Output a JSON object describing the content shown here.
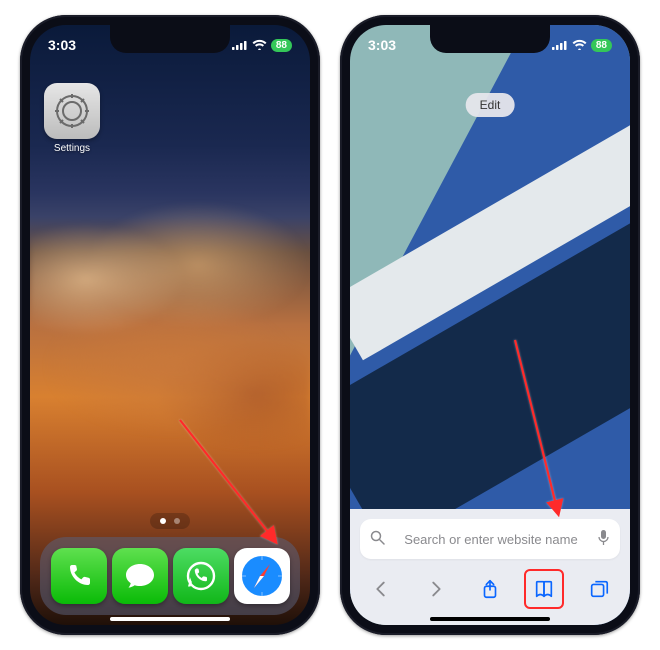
{
  "left": {
    "status_time": "3:03",
    "battery_pct": "88",
    "settings_label": "Settings",
    "dock": {
      "phone": "Phone",
      "messages": "Messages",
      "whatsapp": "WhatsApp",
      "safari": "Safari"
    }
  },
  "right": {
    "status_time": "3:03",
    "battery_pct": "88",
    "edit_label": "Edit",
    "search_placeholder": "Search or enter website name",
    "toolbar": {
      "back": "Back",
      "forward": "Forward",
      "share": "Share",
      "bookmarks": "Bookmarks",
      "tabs": "Tabs"
    }
  },
  "colors": {
    "accent_blue": "#0a66ff",
    "highlight_red": "#ff2a2a",
    "battery_green": "#34c759"
  }
}
